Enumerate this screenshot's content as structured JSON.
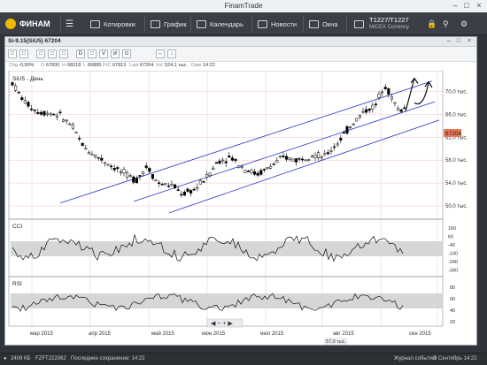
{
  "window": {
    "title": "FinamTrade"
  },
  "toolbar": {
    "logo": "ФИНАМ",
    "items": [
      "Котировки",
      "График",
      "Календарь",
      "Новости",
      "Окна"
    ],
    "account": "T1227/T1227",
    "account_sub": "MICEX Currency"
  },
  "chart_window": {
    "title": "Si-9.15(SiU5) 67204",
    "tools": [
      "□",
      "□",
      "□",
      "□",
      "□",
      "D",
      "□",
      "V",
      "⊘",
      "⊙",
      "↔",
      "↕"
    ],
    "info": {
      "chg_label": "Chg",
      "chg": "-0,90%",
      "o_label": "O",
      "o": "67830",
      "h_label": "H",
      "h": "68218",
      "l_label": "L",
      "l": "66885",
      "prc_label": "PrC",
      "prc": "67813",
      "last_label": "Last",
      "last": "67204",
      "vol_label": "Vol",
      "vol": "524,1 тыс.",
      "date_label": "Date",
      "date": "14:22"
    },
    "series_label": "SiU5 - День",
    "indicator1": "CCI",
    "indicator2": "RSI",
    "current_price_tag": "67204"
  },
  "chart_data": {
    "type": "candlestick",
    "price_axis_ticks": [
      "70,0 тыс.",
      "66,0 тыс.",
      "62,0 тыс.",
      "58,0 тыс.",
      "54,0 тыс.",
      "50,0 тыс."
    ],
    "cci_axis_ticks": [
      "160",
      "60",
      "-40",
      "-140",
      "-240",
      "-340"
    ],
    "rsi_axis_ticks": [
      "80",
      "60",
      "40",
      "20"
    ],
    "x_labels": [
      "мар 2015",
      "апр 2015",
      "май 2015",
      "июн 2015",
      "июл 2015",
      "авг 2015",
      "сен 2015"
    ],
    "cursor_label": "57,0 тыс.",
    "current_price": 67204
  },
  "status": {
    "size": "2409 КБ",
    "version": "FZFT222062",
    "save": "Последнее сохранение: 14:22",
    "journal": "Журнал событий",
    "clock": "3 Сентябрь 14:22"
  }
}
